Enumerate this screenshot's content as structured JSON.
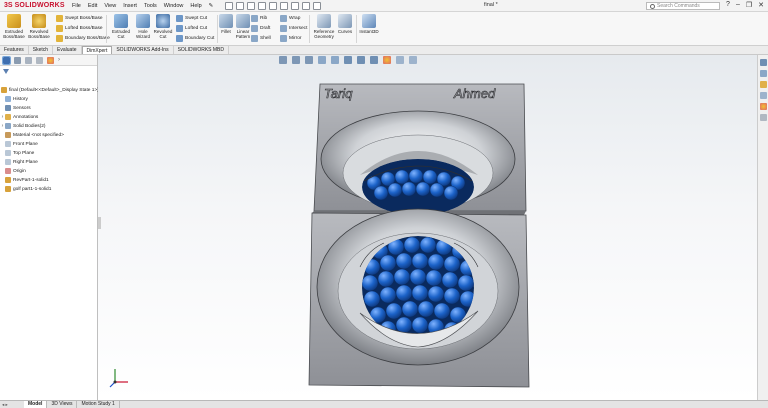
{
  "app": {
    "logo_ds": "3S",
    "logo_name": "SOLIDWORKS",
    "filename": "final *"
  },
  "menus": [
    "File",
    "Edit",
    "View",
    "Insert",
    "Tools",
    "Window",
    "Help"
  ],
  "search": {
    "placeholder": "Search Commands"
  },
  "ribbon": {
    "extruded_boss": "Extruded Boss/Base",
    "revolved_boss": "Revolved Boss/Base",
    "swept_boss": "Swept Boss/Base",
    "lofted_boss": "Lofted Boss/Base",
    "boundary_boss": "Boundary Boss/Base",
    "extruded_cut": "Extruded Cut",
    "hole_wizard": "Hole Wizard",
    "revolved_cut": "Revolved Cut",
    "swept_cut": "Swept Cut",
    "lofted_cut": "Lofted Cut",
    "boundary_cut": "Boundary Cut",
    "fillet": "Fillet",
    "linear_pattern": "Linear Pattern",
    "rib": "Rib",
    "draft": "Draft",
    "shell": "Shell",
    "wrap": "Wrap",
    "intersect": "Intersect",
    "mirror": "Mirror",
    "reference_geometry": "Reference Geometry",
    "curves": "Curves",
    "instant3d": "Instant3D"
  },
  "cmd_tabs": [
    "Features",
    "Sketch",
    "Evaluate",
    "DimXpert",
    "SOLIDWORKS Add-Ins",
    "SOLIDWORKS MBD"
  ],
  "cmd_tab_active": "DimXpert",
  "tree": {
    "root": "final (Default<<Default>_Display State 1>)",
    "items": [
      "History",
      "Sensors",
      "Annotations",
      "Solid Bodies(2)",
      "Material <not specified>",
      "Front Plane",
      "Top Plane",
      "Right Plane",
      "Origin",
      "RevPart-1-solid1",
      "golf part1-1-solid1"
    ]
  },
  "model": {
    "engraving_left": "Tariq",
    "engraving_right": "Ahmed"
  },
  "bottom_tabs": [
    "Model",
    "3D Views",
    "Motion Study 1"
  ],
  "bottom_tab_active": "Model",
  "colors": {
    "brand": "#c8102e",
    "ball_blue": "#1c63c9",
    "cube_gray": "#a9abb0",
    "accent": "#5b7fb0"
  }
}
